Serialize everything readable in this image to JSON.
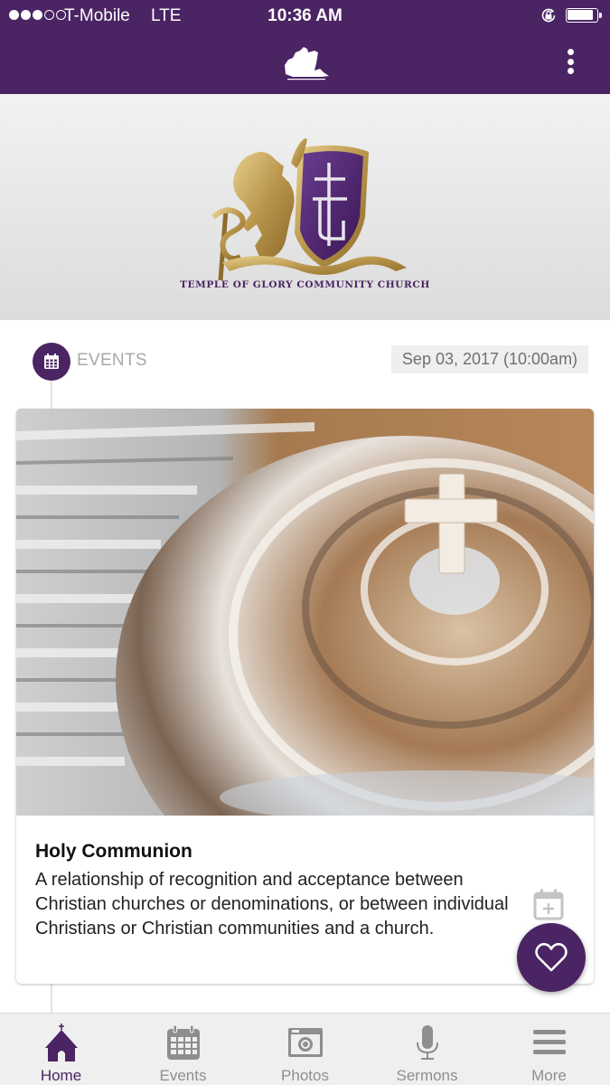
{
  "status_bar": {
    "signal_bars_filled": 3,
    "signal_bars_total": 5,
    "carrier": "T-Mobile",
    "network": "LTE",
    "time": "10:36 AM",
    "rotation_lock_icon": "rotation-lock-icon",
    "battery_icon": "battery-icon"
  },
  "nav_bar": {
    "logo_icon": "church-logo-icon",
    "menu_icon": "kebab-menu-icon"
  },
  "hero": {
    "church_name": "TEMPLE OF GLORY COMMUNITY CHURCH",
    "crest_icon": "lion-shield-crest"
  },
  "feed": {
    "section_icon": "calendar-icon",
    "section_label": "EVENTS",
    "date": "Sep 03, 2017 (10:00am)",
    "event": {
      "image": "communion-trays-photo",
      "title": "Holy Communion",
      "description": "A relationship of recognition and acceptance between Christian churches or denominations, or between individual Christians or Christian communities and a church.",
      "add_to_calendar_icon": "calendar-plus-icon"
    }
  },
  "fab": {
    "icon": "heart-icon"
  },
  "tabs": [
    {
      "label": "Home",
      "icon": "church-icon",
      "active": true
    },
    {
      "label": "Events",
      "icon": "calendar-icon",
      "active": false
    },
    {
      "label": "Photos",
      "icon": "camera-icon",
      "active": false
    },
    {
      "label": "Sermons",
      "icon": "microphone-icon",
      "active": false
    },
    {
      "label": "More",
      "icon": "hamburger-icon",
      "active": false
    }
  ],
  "colors": {
    "brand_purple": "#4a2463",
    "muted_gray": "#8e8e8e",
    "gold": "#c9a85a"
  }
}
